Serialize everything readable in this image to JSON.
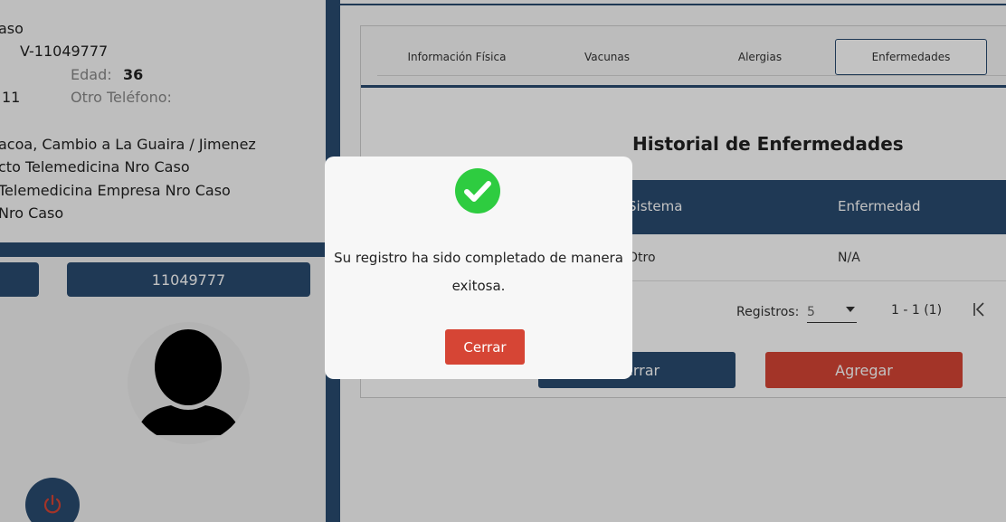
{
  "patient": {
    "line1": "aso",
    "id_number": "V-11049777",
    "age_label": "Edad:",
    "age_value": "36",
    "phone_fragment": "11",
    "other_phone_label": "Otro Teléfono:",
    "address": "acoa, Cambio a La Guaira / Jimenez",
    "product": "cto Telemedicina Nro Caso",
    "company": "Telemedicina Empresa Nro Caso",
    "case": " Nro Caso"
  },
  "left_buttons": {
    "id_button": "11049777"
  },
  "tabs": [
    {
      "label": "Información Física"
    },
    {
      "label": "Vacunas"
    },
    {
      "label": "Alergias"
    },
    {
      "label": "Enfermedades",
      "active": true
    }
  ],
  "section": {
    "title": "Historial de Enfermedades"
  },
  "table": {
    "headers": [
      "Sistema",
      "Enfermedad"
    ],
    "rows": [
      [
        "Otro",
        "N/A"
      ]
    ]
  },
  "pagination": {
    "label": "Registros:",
    "page_size": "5",
    "range": "1 - 1 (1)"
  },
  "actions": {
    "close_label": "Cerrar",
    "add_label": "Agregar"
  },
  "modal": {
    "icon": "check-circle-icon",
    "message": "Su registro ha sido completado de manera exitosa.",
    "button_label": "Cerrar"
  },
  "colors": {
    "primary": "#2a4b70",
    "danger": "#d64535",
    "success": "#2ecc40"
  }
}
